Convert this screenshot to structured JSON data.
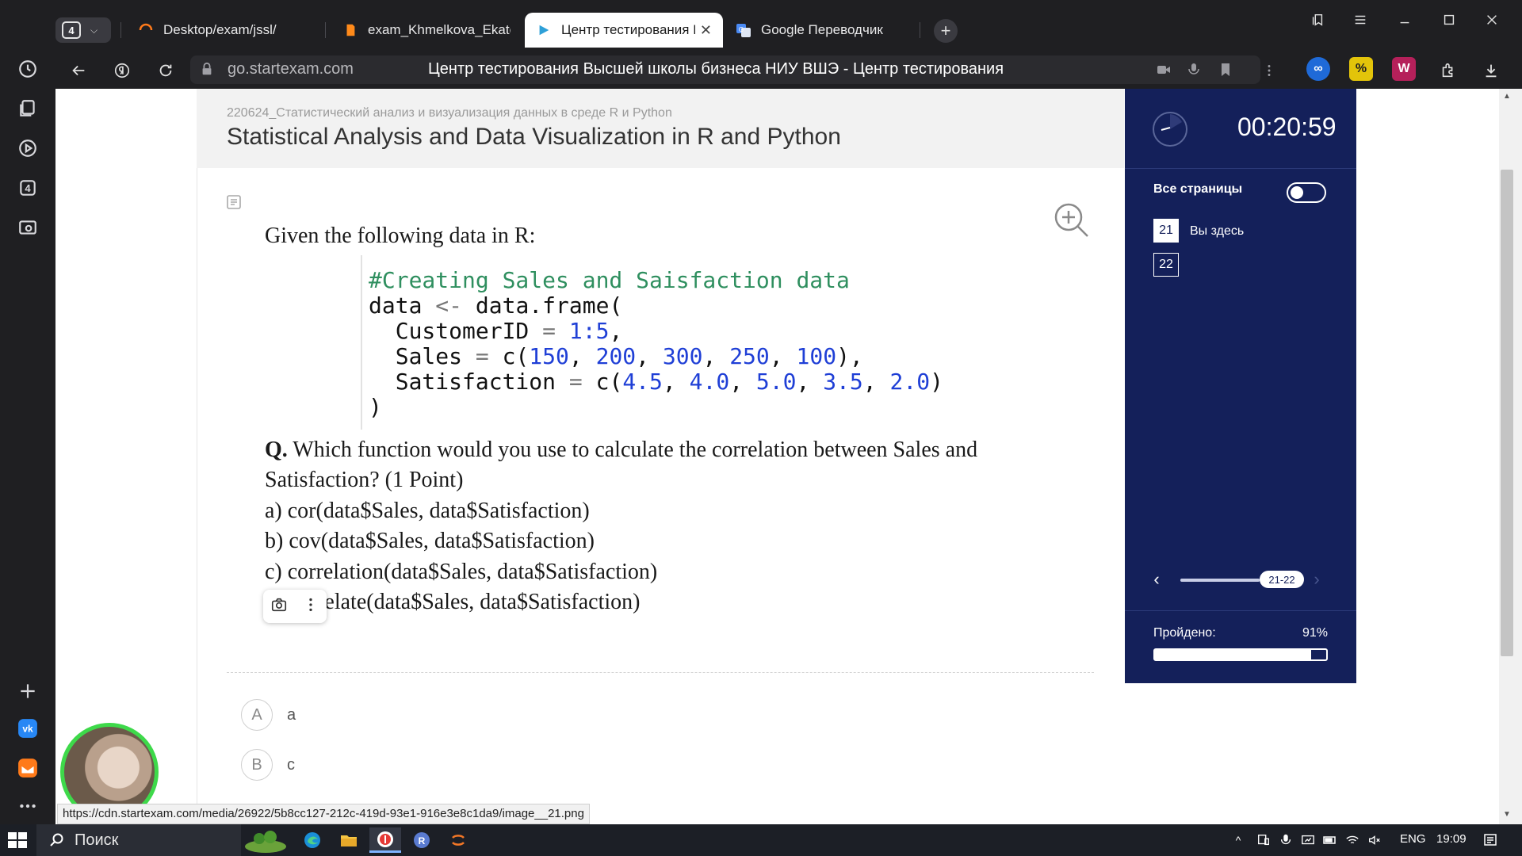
{
  "browser": {
    "tab_count": "4",
    "tabs": [
      {
        "title": "Desktop/exam/jssl/"
      },
      {
        "title": "exam_Khmelkova_Ekaterin"
      },
      {
        "title": "Центр тестирования Вы"
      },
      {
        "title": "Google Переводчик"
      }
    ],
    "url_host": "go.startexam.com",
    "page_title": "Центр тестирования Высшей школы бизнеса НИУ ВШЭ - Центр тестирования",
    "rail_badge": "4",
    "status_url": "https://cdn.startexam.com/media/26922/5b8cc127-212c-419d-93e1-916e3e8c1da9/image__21.png"
  },
  "header": {
    "course_code": "220624_Статистический анализ и визуализация данных в среде R и Python",
    "course_title": "Statistical Analysis and Data Visualization in R and Python"
  },
  "question": {
    "intro": "Given the following data in R:",
    "code": {
      "comment": "#Creating Sales and Saisfaction data",
      "line1_a": "data ",
      "line1_op": "<-",
      "line1_b": " data.frame(",
      "line2_a": "  CustomerID ",
      "line2_op": "=",
      "line2_num": " 1:5",
      "line2_b": ",",
      "line3_a": "  Sales ",
      "line3_op": "=",
      "line3_b": " c(",
      "line3_nums": [
        "150",
        "200",
        "300",
        "250",
        "100"
      ],
      "line3_end": "),",
      "line4_a": "  Satisfaction ",
      "line4_op": "=",
      "line4_b": " c(",
      "line4_nums": [
        "4.5",
        "4.0",
        "5.0",
        "3.5",
        "2.0"
      ],
      "line4_end": ")",
      "line5": ")"
    },
    "q_prefix": "Q.",
    "q_line1": " Which function would you use to calculate the correlation between Sales and",
    "q_line2": "Satisfaction? (1 Point)",
    "options": [
      "a) cor(data$Sales, data$Satisfaction)",
      "b) cov(data$Sales, data$Satisfaction)",
      "c) correlation(data$Sales, data$Satisfaction)",
      "d) correlate(data$Sales, data$Satisfaction)"
    ]
  },
  "answers": [
    {
      "badge": "A",
      "text": "a"
    },
    {
      "badge": "B",
      "text": "c"
    }
  ],
  "panel": {
    "timer": "00:20:59",
    "all_pages_label": "Все страницы",
    "all_pages_on": false,
    "pages": [
      "21",
      "22"
    ],
    "current_page_label": "Вы здесь",
    "pager_label": "21-22",
    "progress_label": "Пройдено:",
    "progress_value": "91%",
    "progress_fraction": 0.91
  },
  "taskbar": {
    "search_label": "Поиск",
    "lang": "ENG",
    "time": "19:09"
  },
  "colors": {
    "panel_bg": "#14205a",
    "accent_green": "#3ed94a",
    "code_comment": "#2f8f5f",
    "code_number": "#1f3fd6"
  }
}
